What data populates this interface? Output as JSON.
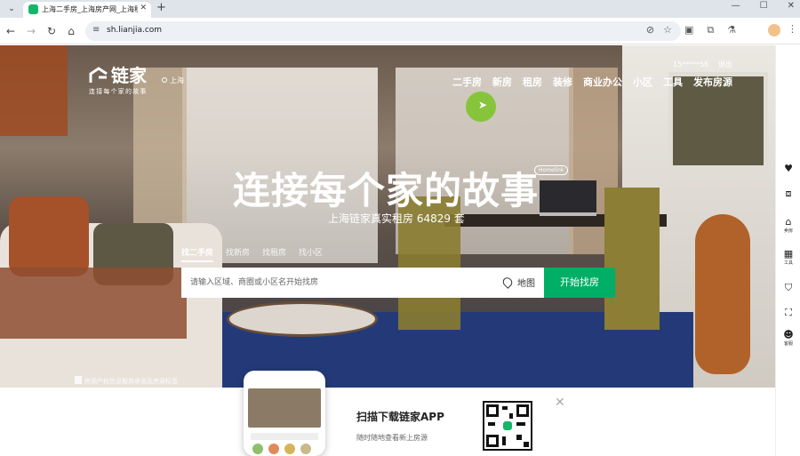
{
  "browser": {
    "tab_title": "上海二手房_上海房产网_上海租",
    "url": "sh.lianjia.com"
  },
  "site": {
    "logo_text": "链家",
    "slogan": "连接每个家的故事",
    "city": "上海",
    "user": {
      "phone": "15*****56",
      "logout": "退出"
    },
    "nav": [
      "二手房",
      "新房",
      "租房",
      "装修",
      "商业办公",
      "小区",
      "工具",
      "发布房源"
    ],
    "accent_color": "#00ae66"
  },
  "hero": {
    "headline": "连接每个家的故事",
    "badge": "Homelink",
    "subline": "上海链家真实租房 64829 套"
  },
  "search": {
    "tabs": [
      "找二手房",
      "找新房",
      "找租房",
      "找小区"
    ],
    "active_tab": 0,
    "placeholder": "请输入区域、商圈或小区名开始找房",
    "map_label": "地图",
    "button_label": "开始找房"
  },
  "license_text": "房源产权信息服务承诺及房源标签",
  "sidebar": [
    {
      "icon": "heart-icon",
      "label": ""
    },
    {
      "icon": "compare-icon",
      "label": ""
    },
    {
      "icon": "house-icon",
      "label": "卖房"
    },
    {
      "icon": "grid-icon",
      "label": "工具"
    },
    {
      "icon": "shield-icon",
      "label": ""
    },
    {
      "icon": "scan-icon",
      "label": ""
    },
    {
      "icon": "chat-icon",
      "label": "客服"
    }
  ],
  "promo": {
    "title": "扫描下载链家APP",
    "subtitle": "随时随地查看新上房源"
  }
}
